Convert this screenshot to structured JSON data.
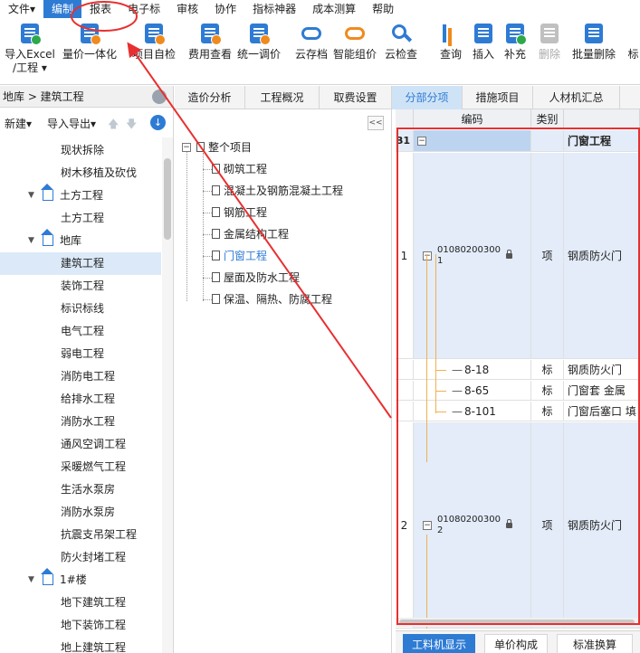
{
  "menubar": {
    "items": [
      "文件▾",
      "编制",
      "报表",
      "电子标",
      "审核",
      "协作",
      "指标神器",
      "成本测算",
      "帮助"
    ]
  },
  "toolbar": {
    "buttons": [
      {
        "label": "导入Excel",
        "label2": "/工程 ▾",
        "icon": "import-excel-icon"
      },
      {
        "label": "量价一体化",
        "icon": "price-integration-icon"
      },
      {
        "label": "项目自检",
        "icon": "self-check-icon"
      },
      {
        "label": "费用查看",
        "icon": "cost-view-icon"
      },
      {
        "label": "统一调价",
        "icon": "unified-pricing-icon"
      },
      {
        "label": "云存档",
        "icon": "cloud-archive-icon"
      },
      {
        "label": "智能组价",
        "icon": "smart-pricing-icon"
      },
      {
        "label": "云检查",
        "icon": "cloud-check-icon"
      },
      {
        "label": "查询",
        "icon": "query-icon"
      },
      {
        "label": "插入",
        "icon": "insert-icon"
      },
      {
        "label": "补充",
        "icon": "supplement-icon"
      },
      {
        "label": "删除",
        "icon": "delete-icon"
      },
      {
        "label": "批量删除",
        "icon": "batch-delete-icon"
      },
      {
        "label": "标",
        "icon": "mark-icon"
      }
    ]
  },
  "left": {
    "breadcrumb": "地库 > 建筑工程",
    "new_label": "新建▾",
    "import_export_label": "导入导出▾",
    "up_arrow": "🡅",
    "down_arrow": "🡇",
    "tree": [
      {
        "label": "现状拆除",
        "level": 2
      },
      {
        "label": "树木移植及砍伐",
        "level": 2
      },
      {
        "label": "土方工程",
        "level": 1,
        "expanded": true
      },
      {
        "label": "土方工程",
        "level": 2
      },
      {
        "label": "地库",
        "level": 1,
        "expanded": true
      },
      {
        "label": "建筑工程",
        "level": 2,
        "selected": true
      },
      {
        "label": "装饰工程",
        "level": 2
      },
      {
        "label": "标识标线",
        "level": 2
      },
      {
        "label": "电气工程",
        "level": 2
      },
      {
        "label": "弱电工程",
        "level": 2
      },
      {
        "label": "消防电工程",
        "level": 2
      },
      {
        "label": "给排水工程",
        "level": 2
      },
      {
        "label": "消防水工程",
        "level": 2
      },
      {
        "label": "通风空调工程",
        "level": 2
      },
      {
        "label": "采暖燃气工程",
        "level": 2
      },
      {
        "label": "生活水泵房",
        "level": 2
      },
      {
        "label": "消防水泵房",
        "level": 2
      },
      {
        "label": "抗震支吊架工程",
        "level": 2
      },
      {
        "label": "防火封堵工程",
        "level": 2
      },
      {
        "label": "1#楼",
        "level": 1,
        "expanded": true
      },
      {
        "label": "地下建筑工程",
        "level": 2
      },
      {
        "label": "地下装饰工程",
        "level": 2
      },
      {
        "label": "地上建筑工程",
        "level": 2
      }
    ]
  },
  "tabs": [
    "造价分析",
    "工程概况",
    "取费设置",
    "分部分项",
    "措施项目",
    "人材机汇总"
  ],
  "active_tab": "分部分项",
  "middle_tree": {
    "collapse": "<<",
    "root": "整个项目",
    "items": [
      {
        "label": "砌筑工程"
      },
      {
        "label": "混凝土及钢筋混凝土工程"
      },
      {
        "label": "钢筋工程"
      },
      {
        "label": "金属结构工程"
      },
      {
        "label": "门窗工程",
        "selected": true
      },
      {
        "label": "屋面及防水工程"
      },
      {
        "label": "保温、隔热、防腐工程"
      }
    ]
  },
  "grid": {
    "headers": [
      "编码",
      "类别",
      ""
    ],
    "section_id": "B1",
    "section_name": "门窗工程",
    "rows": [
      {
        "idx": "1",
        "code": "01080200300",
        "code2": "1",
        "type": "项",
        "name": "钢质防火门"
      },
      {
        "idx": "",
        "code": "8-18",
        "type": "标",
        "name": "钢质防火门"
      },
      {
        "idx": "",
        "code": "8-65",
        "type": "标",
        "name": "门窗套 金属"
      },
      {
        "idx": "",
        "code": "8-101",
        "type": "标",
        "name": "门窗后塞口 填"
      },
      {
        "idx": "2",
        "code": "01080200300",
        "code2": "2",
        "type": "项",
        "name": "钢质防火门"
      }
    ]
  },
  "bottom_tabs": [
    "工料机显示",
    "单价构成",
    "标准换算"
  ],
  "colors": {
    "accent": "#2e7bd4",
    "annotation": "#e83030"
  }
}
